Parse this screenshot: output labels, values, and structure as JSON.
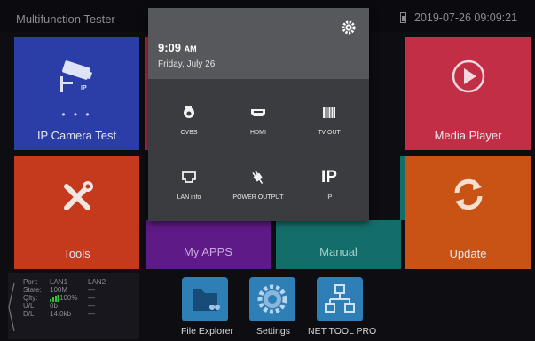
{
  "status_bar": {
    "app_title": "Multifunction Tester",
    "datetime": "2019-07-26 09:09:21"
  },
  "tiles": {
    "ip_camera_test": "IP Camera Test",
    "ip_badge": "IP",
    "dots": "• • •",
    "tools": "Tools",
    "my_apps": "My APPS",
    "manual": "Manual",
    "media_player": "Media Player",
    "update": "Update"
  },
  "lan_status": {
    "headers": [
      "Port:",
      "LAN1",
      "LAN2"
    ],
    "rows": [
      {
        "label": "State:",
        "lan1": "100M",
        "lan2": "—"
      },
      {
        "label": "Qlty:",
        "lan1": "100%",
        "lan2": "—"
      },
      {
        "label": "U/L:",
        "lan1": "0b",
        "lan2": "—"
      },
      {
        "label": "D/L:",
        "lan1": "14.0kb",
        "lan2": "—"
      }
    ]
  },
  "dock": [
    {
      "label": "File Explorer",
      "color": "#2e7fb6"
    },
    {
      "label": "Settings",
      "color": "#2e7fb6"
    },
    {
      "label": "NET TOOL PRO",
      "color": "#2e7fb6"
    }
  ],
  "notification_shade": {
    "time": "9:09",
    "ampm": "AM",
    "date": "Friday, July 26",
    "tiles": [
      {
        "label": "CVBS",
        "icon": "camera-icon"
      },
      {
        "label": "HDMI",
        "icon": "hdmi-icon"
      },
      {
        "label": "TV OUT",
        "icon": "tv-out-icon"
      },
      {
        "label": "LAN info",
        "icon": "lan-port-icon"
      },
      {
        "label": "POWER OUTPUT",
        "icon": "power-plug-icon"
      },
      {
        "label": "IP",
        "icon": "ip-text-icon",
        "glyph": "IP"
      }
    ]
  },
  "colors": {
    "ip_camera_tile": "#2b3da6",
    "tools_tile": "#c53a1d",
    "my_apps_tile": "#5e1a86",
    "manual_tile": "#136e6a",
    "media_player_tile": "#c22e46",
    "update_tile": "#c85314",
    "shade_background": "#3b3c3f",
    "signal_green": "#35c23a"
  }
}
